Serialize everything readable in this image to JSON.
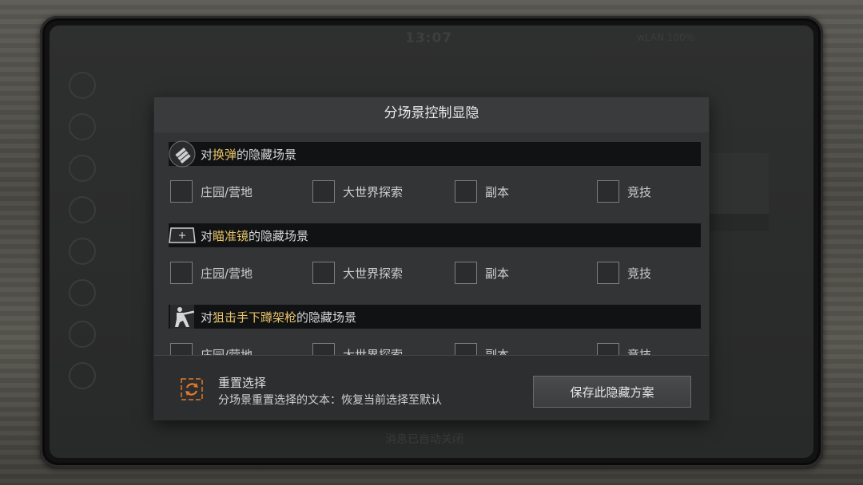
{
  "background": {
    "clock": "13:07",
    "status": "wLAN 100%",
    "footer_hint": "消息已自动关闭"
  },
  "dialog": {
    "title": "分场景控制显隐",
    "sections": [
      {
        "icon": "bullets-icon",
        "prefix": "对",
        "highlight": "换弹",
        "suffix": "的隐藏场景",
        "options": [
          "庄园/营地",
          "大世界探索",
          "副本",
          "竞技"
        ]
      },
      {
        "icon": "scope-icon",
        "prefix": "对",
        "highlight": "瞄准镜",
        "suffix": "的隐藏场景",
        "options": [
          "庄园/营地",
          "大世界探索",
          "副本",
          "竞技"
        ]
      },
      {
        "icon": "sniper-crouch-icon",
        "prefix": "对",
        "highlight": "狙击手下蹲架枪",
        "suffix": "的隐藏场景",
        "options": [
          "庄园/营地",
          "大世界探索",
          "副本",
          "竞技"
        ]
      }
    ],
    "footer": {
      "reset_title": "重置选择",
      "reset_desc": "分场景重置选择的文本：恢复当前选择至默认",
      "save_label": "保存此隐藏方案"
    }
  },
  "colors": {
    "highlight": "#e8c46a",
    "reset_icon": "#e07a2a"
  }
}
